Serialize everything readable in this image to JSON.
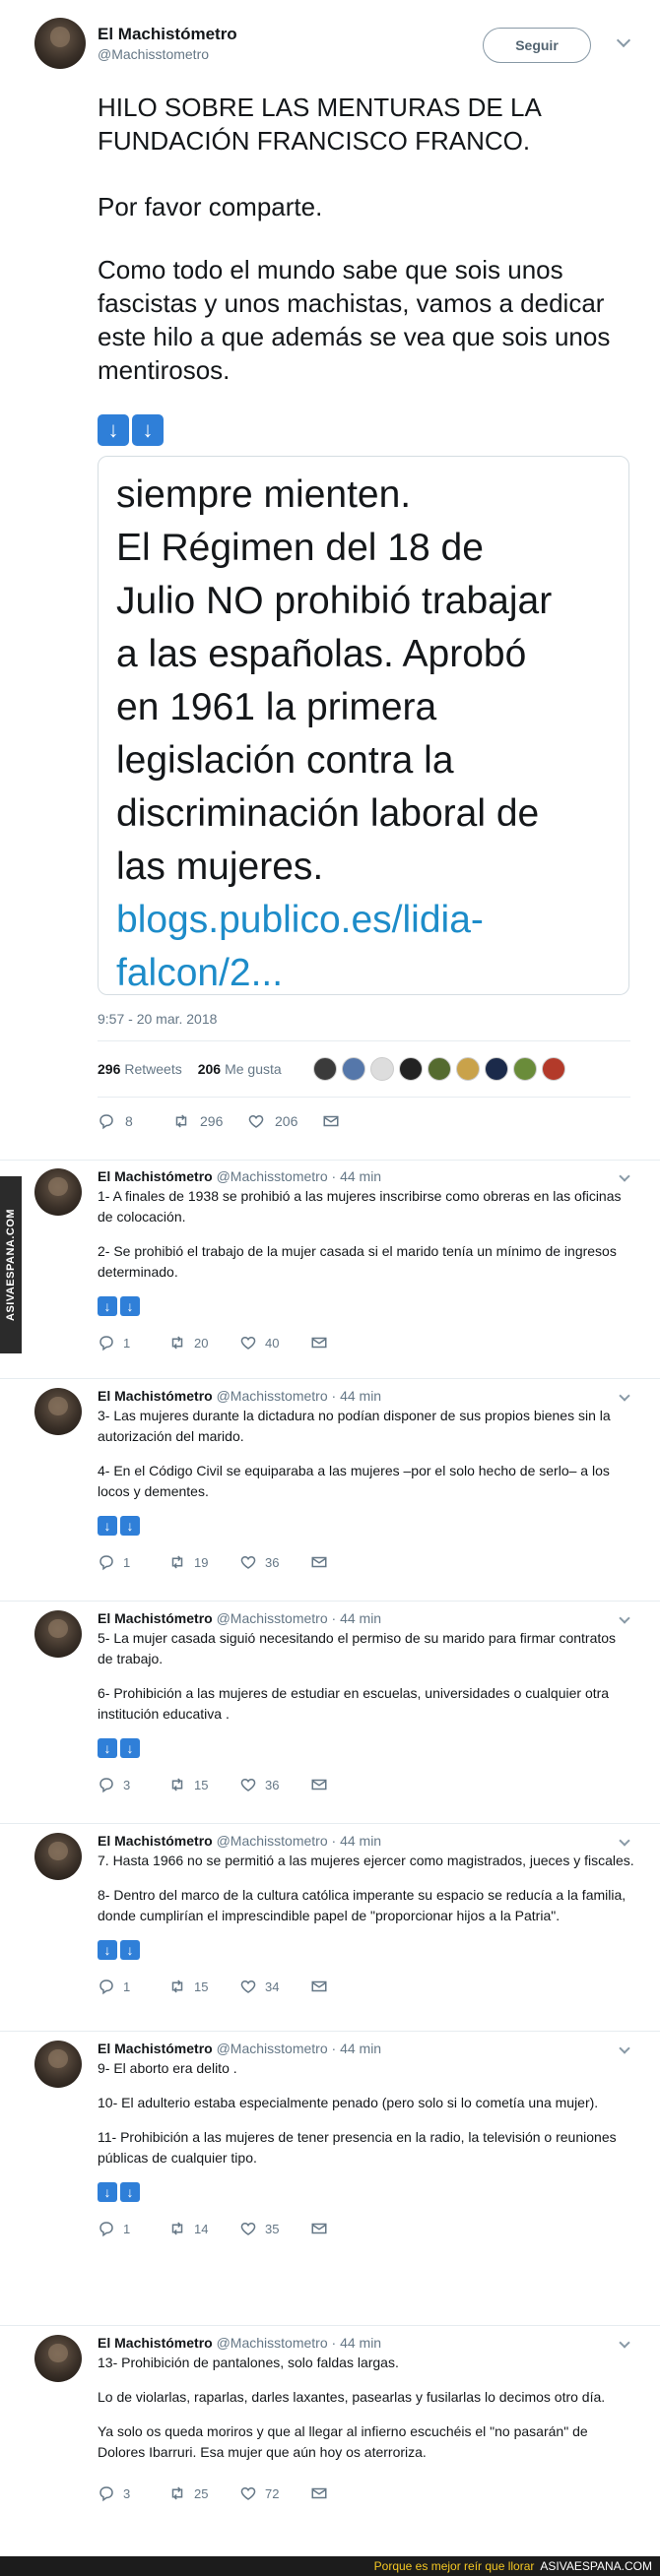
{
  "watermark": "ASIVAESPANA.COM",
  "main": {
    "name": "El Machistómetro",
    "handle": "@Machisstometro",
    "follow_label": "Seguir",
    "paragraphs": [
      "HILO SOBRE LAS MENTURAS DE LA FUNDACIÓN FRANCISCO FRANCO.",
      "Por favor comparte.",
      "Como todo el mundo sabe que sois unos fascistas y unos machistas, vamos a dedicar este hilo a que además se vea que sois unos mentirosos."
    ],
    "card_lines": [
      "siempre mienten.",
      "El Régimen del 18 de",
      "Julio NO prohibió trabajar",
      "a las españolas. Aprobó",
      "en 1961 la primera",
      "legislación contra la",
      "discriminación laboral de",
      "las mujeres."
    ],
    "card_link_lines": [
      "blogs.publico.es/lidia-",
      "falcon/2..."
    ],
    "timestamp": "9:57 - 20 mar. 2018",
    "retweets_count": "296",
    "retweets_label": "Retweets",
    "likes_count": "206",
    "likes_label": "Me gusta",
    "actions": {
      "reply": "8",
      "retweet": "296",
      "like": "206"
    }
  },
  "replies": [
    {
      "name": "El Machistómetro",
      "handle": "@Machisstometro",
      "time": "· 44 min",
      "paragraphs": [
        "1- A finales de 1938 se prohibió a las mujeres inscribirse como obreras en las oficinas de colocación.",
        "2- Se prohibió el trabajo de la mujer casada si el marido tenía un mínimo de ingresos determinado."
      ],
      "has_arrows": true,
      "actions": {
        "reply": "1",
        "retweet": "20",
        "like": "40"
      }
    },
    {
      "name": "El Machistómetro",
      "handle": "@Machisstometro",
      "time": "· 44 min",
      "paragraphs": [
        "3- Las mujeres durante la dictadura no podían disponer de sus propios bienes sin la autorización del marido.",
        "4- En el Código Civil se equiparaba a las mujeres –por el solo hecho de serlo– a los locos y dementes."
      ],
      "has_arrows": true,
      "actions": {
        "reply": "1",
        "retweet": "19",
        "like": "36"
      }
    },
    {
      "name": "El Machistómetro",
      "handle": "@Machisstometro",
      "time": "· 44 min",
      "paragraphs": [
        "5- La mujer casada siguió necesitando el permiso de su marido para firmar contratos de trabajo.",
        "6- Prohibición a las mujeres de estudiar en escuelas, universidades o cualquier otra institución educativa ."
      ],
      "has_arrows": true,
      "actions": {
        "reply": "3",
        "retweet": "15",
        "like": "36"
      }
    },
    {
      "name": "El Machistómetro",
      "handle": "@Machisstometro",
      "time": "· 44 min",
      "paragraphs": [
        "7. Hasta 1966 no se permitió a las mujeres ejercer como magistrados, jueces y fiscales.",
        "8- Dentro del marco de la cultura católica imperante su espacio se reducía a la familia, donde cumplirían el imprescindible papel de \"proporcionar hijos a la Patria\"."
      ],
      "has_arrows": true,
      "actions": {
        "reply": "1",
        "retweet": "15",
        "like": "34"
      }
    },
    {
      "name": "El Machistómetro",
      "handle": "@Machisstometro",
      "time": "· 44 min",
      "paragraphs": [
        "9- El aborto era delito .",
        "10- El adulterio estaba especialmente penado (pero solo si lo cometía una mujer).",
        "11- Prohibición a las mujeres de tener presencia en la radio, la televisión o reuniones públicas de cualquier tipo."
      ],
      "has_arrows": true,
      "actions": {
        "reply": "1",
        "retweet": "14",
        "like": "35"
      }
    },
    {
      "name": "El Machistómetro",
      "handle": "@Machisstometro",
      "time": "· 44 min",
      "paragraphs": [
        "13- Prohibición de pantalones, solo faldas largas.",
        "Lo de violarlas, raparlas, darles laxantes, pasearlas y fusilarlas lo decimos otro día.",
        "Ya solo os queda moriros y que al llegar al infierno escuchéis el \"no pasarán\" de Dolores Ibarruri. Esa mujer que aún hoy os aterroriza."
      ],
      "has_arrows": false,
      "actions": {
        "reply": "3",
        "retweet": "25",
        "like": "72"
      }
    }
  ],
  "footer": {
    "left": "Porque es mejor reír que llorar",
    "right": "ASIVAESPANA.COM"
  }
}
